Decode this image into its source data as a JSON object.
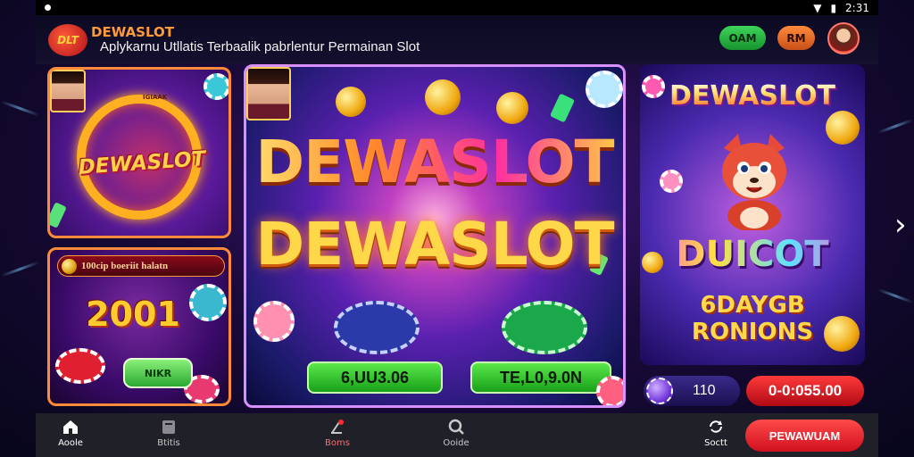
{
  "status_bar": {
    "time": "2:31"
  },
  "header": {
    "brand_name": "DEWASLOT",
    "logo_badge_text": "DLT",
    "tagline": "Aplykarnu Utllatis Terbaalik pabrlentur Permainan Slot",
    "button_green_label": "OAM",
    "button_orange_label": "RM"
  },
  "cards": {
    "left_top": {
      "logo_text": "DEWASLOT",
      "ribbon_text": "IGIAAK"
    },
    "left_bottom": {
      "banner_text": "100cip boeriit halatn",
      "amount": "2001",
      "button_label": "NIKR"
    },
    "center": {
      "title_line_1": "DEWASLOT",
      "title_line_2": "DEWASLOT",
      "pill_1": "6,UU3.06",
      "pill_2": "TE,L0,9.0N"
    },
    "right": {
      "title": "DEWASLOT",
      "subtitle": "DUICOT",
      "caption_line_1": "6DAYGB",
      "caption_line_2": "RONIONS"
    }
  },
  "balance": {
    "value": "110",
    "amount": "0-0:055.00"
  },
  "bottom_nav": {
    "items": [
      {
        "label": "Aoole",
        "icon": "home-icon"
      },
      {
        "label": "Btitis",
        "icon": "stats-icon"
      },
      {
        "label": "Boms",
        "icon": "bonus-icon"
      },
      {
        "label": "Ooide",
        "icon": "search-icon"
      },
      {
        "label": "Soctt",
        "icon": "sync-icon"
      }
    ],
    "cta_label": "PEWAWUAM"
  },
  "colors": {
    "accent_red": "#e8101e",
    "accent_green": "#2aa830",
    "accent_gold": "#ffd04a"
  }
}
